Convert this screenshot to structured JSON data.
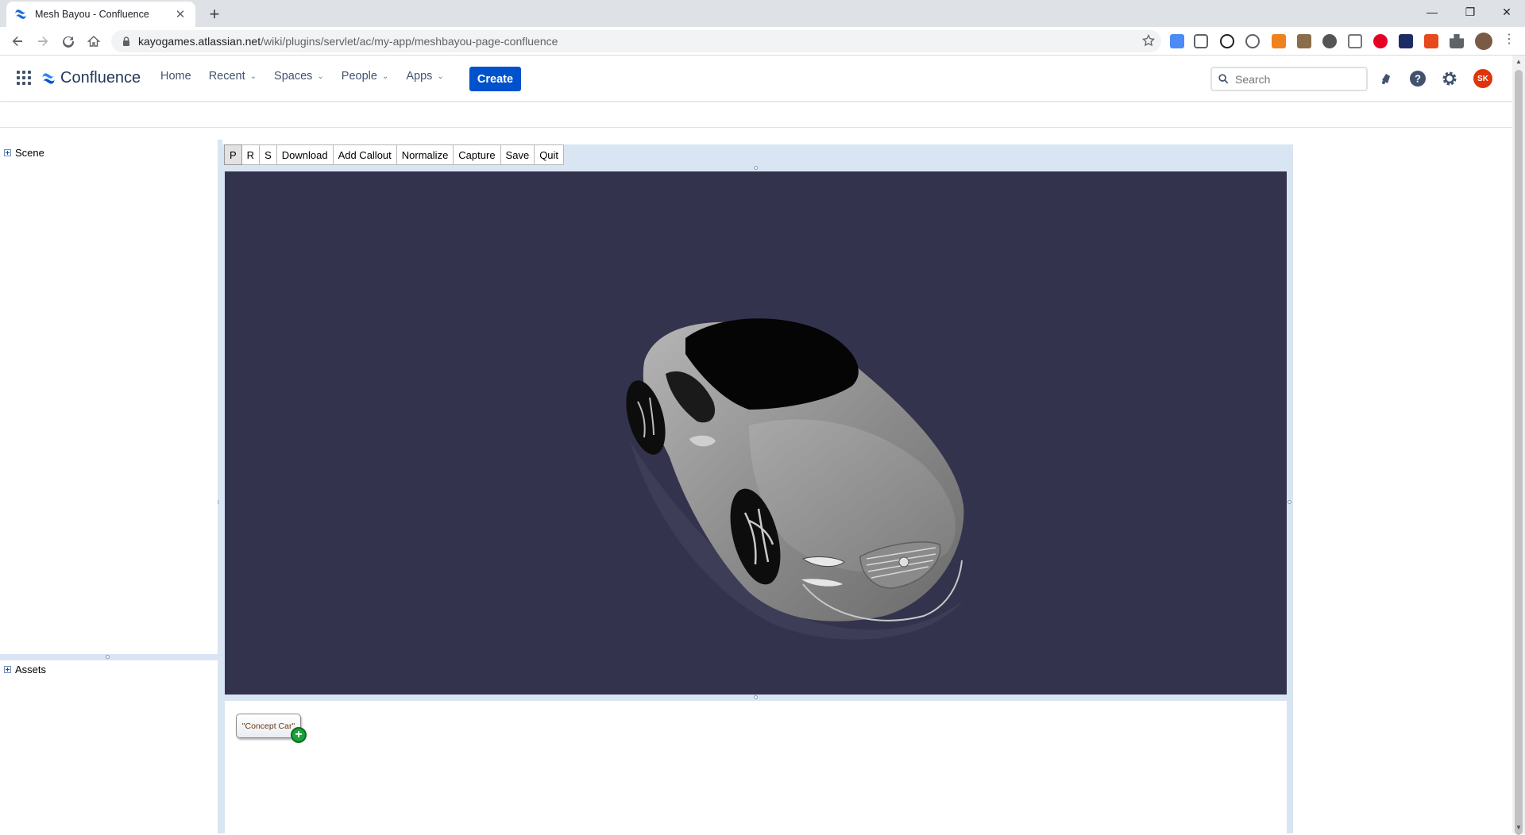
{
  "browser": {
    "tab_title": "Mesh Bayou - Confluence",
    "url_host": "kayogames.atlassian.net",
    "url_path": "/wiki/plugins/servlet/ac/my-app/meshbayou-page-confluence"
  },
  "confluence": {
    "logo_text": "Confluence",
    "nav": {
      "home": "Home",
      "recent": "Recent",
      "spaces": "Spaces",
      "people": "People",
      "apps": "Apps"
    },
    "create_label": "Create",
    "search_placeholder": "Search",
    "avatar_initials": "SK"
  },
  "app": {
    "scene_label": "Scene",
    "assets_label": "Assets",
    "toolbar": {
      "p": "P",
      "r": "R",
      "s": "S",
      "download": "Download",
      "add_callout": "Add Callout",
      "normalize": "Normalize",
      "capture": "Capture",
      "save": "Save",
      "quit": "Quit"
    },
    "asset_node_label": "\"Concept Car\"",
    "asset_add_symbol": "+",
    "viewport_bg": "#33334d"
  }
}
